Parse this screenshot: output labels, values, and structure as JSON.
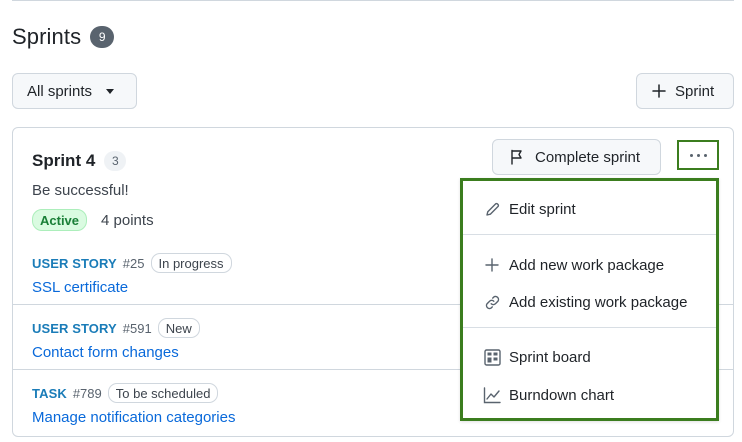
{
  "header": {
    "title": "Sprints",
    "count": "9"
  },
  "toolbar": {
    "filter_label": "All sprints",
    "new_sprint_label": "Sprint"
  },
  "sprint": {
    "name": "Sprint 4",
    "count": "3",
    "description": "Be successful!",
    "status": "Active",
    "points": "4 points",
    "complete_label": "Complete sprint"
  },
  "work_packages": [
    {
      "type": "USER STORY",
      "number": "#25",
      "state": "In progress",
      "title": "SSL certificate"
    },
    {
      "type": "USER STORY",
      "number": "#591",
      "state": "New",
      "title": "Contact form changes"
    },
    {
      "type": "TASK",
      "number": "#789",
      "state": "To be scheduled",
      "title": "Manage notification categories"
    }
  ],
  "menu": {
    "items": [
      {
        "label": "Edit sprint",
        "icon": "pencil-icon"
      },
      {
        "label": "Add new work package",
        "icon": "plus-icon"
      },
      {
        "label": "Add existing work package",
        "icon": "link-icon"
      },
      {
        "label": "Sprint board",
        "icon": "board-icon"
      },
      {
        "label": "Burndown chart",
        "icon": "graph-icon"
      }
    ]
  },
  "colors": {
    "highlight_border": "#3b7d1e",
    "link": "#0969da",
    "type_label": "#1a7cb8",
    "active_green": "#1a7f37"
  }
}
